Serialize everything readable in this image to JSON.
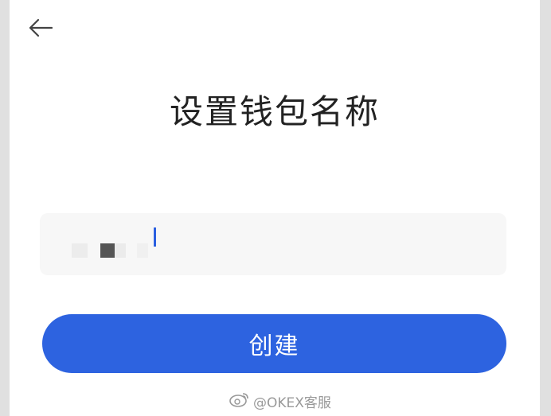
{
  "header": {
    "back_icon": "arrow-left-icon"
  },
  "page": {
    "title": "设置钱包名称"
  },
  "wallet_name_input": {
    "value": "",
    "placeholder": ""
  },
  "create_button": {
    "label": "创建"
  },
  "watermark": {
    "icon": "weibo-icon",
    "text": "@OKEX客服"
  },
  "colors": {
    "accent": "#2d63e0",
    "input_bg": "#f7f7f7",
    "title_text": "#222222"
  }
}
